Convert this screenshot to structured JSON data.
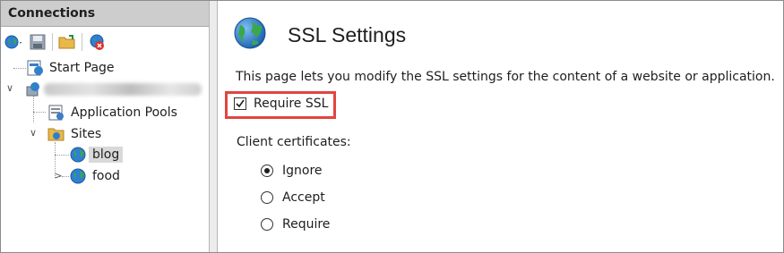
{
  "connections": {
    "header": "Connections",
    "toolbar": [
      {
        "icon": "connect-globe-icon"
      },
      {
        "icon": "save-icon"
      },
      {
        "icon": "open-folder-icon"
      },
      {
        "icon": "disconnect-icon"
      }
    ],
    "tree": {
      "start_page": "Start Page",
      "server": "",
      "app_pools": "Application Pools",
      "sites": "Sites",
      "blog": "blog",
      "food": "food"
    }
  },
  "main": {
    "title": "SSL Settings",
    "description": "This page lets you modify the SSL settings for the content of a website or application.",
    "require_ssl": {
      "label": "Require SSL",
      "checked": true
    },
    "client_certificates": {
      "label": "Client certificates:",
      "options": [
        {
          "label": "Ignore",
          "selected": true
        },
        {
          "label": "Accept",
          "selected": false
        },
        {
          "label": "Require",
          "selected": false
        }
      ]
    }
  },
  "colors": {
    "highlight_border": "#e2453f",
    "header_bg": "#cdcdcd",
    "selected_bg": "#d9d9d9"
  }
}
